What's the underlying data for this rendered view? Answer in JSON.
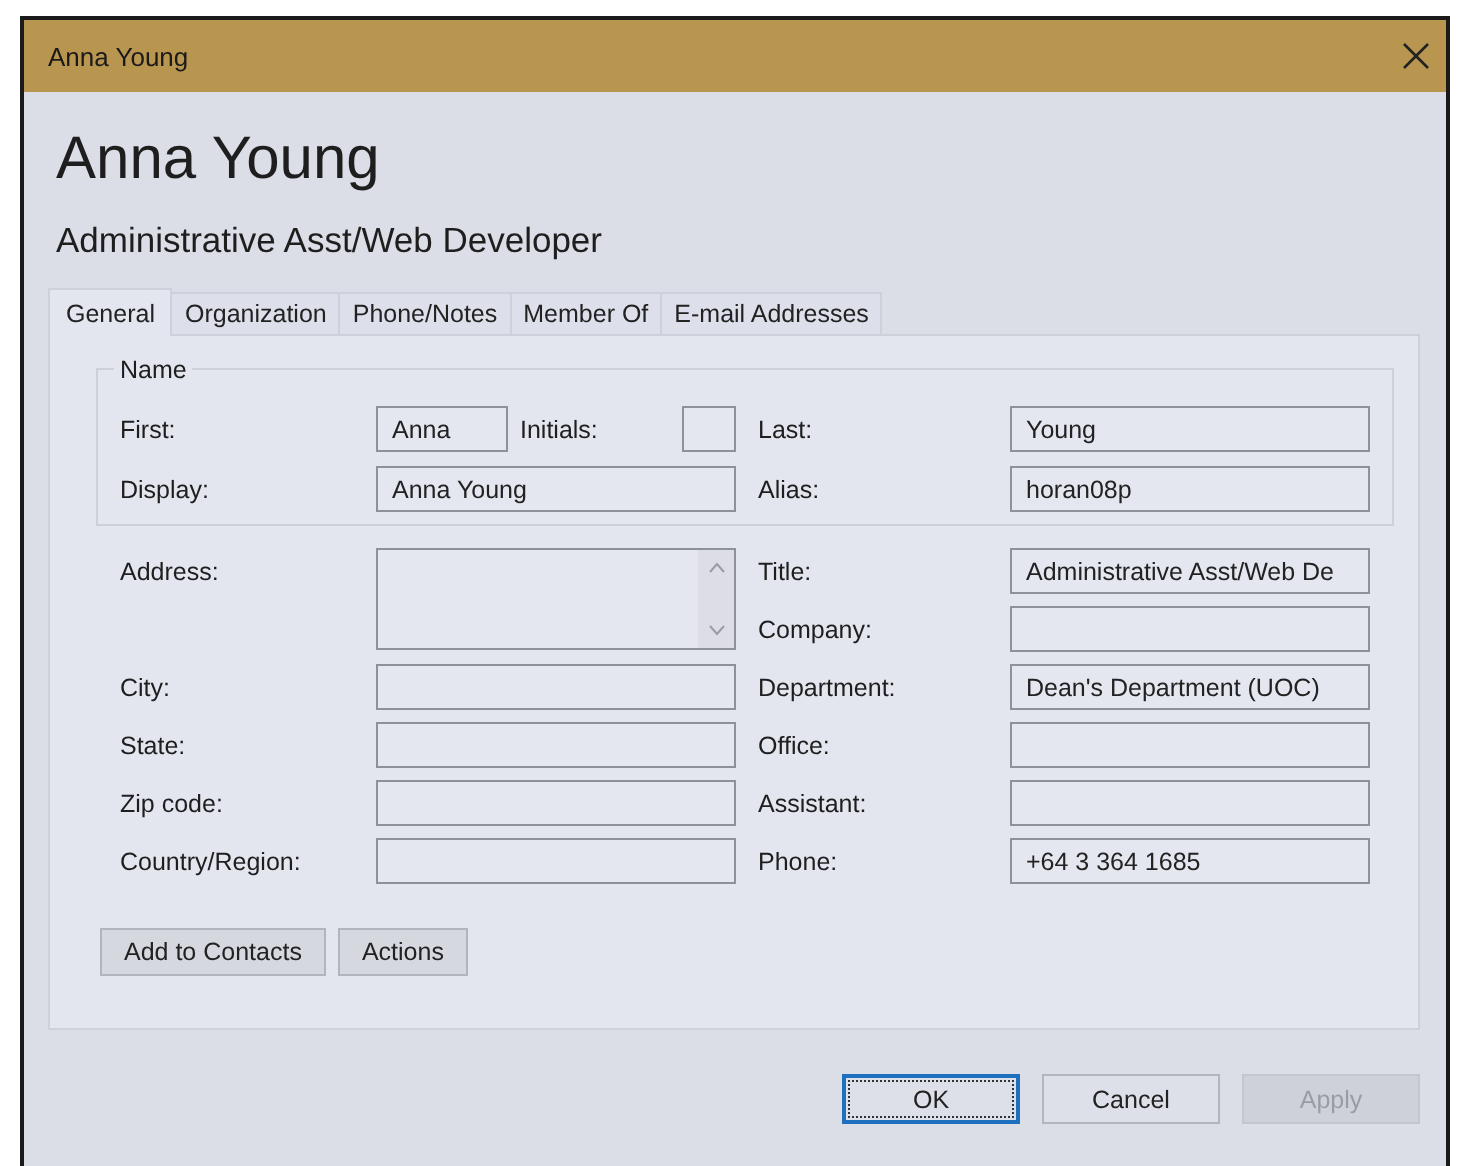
{
  "window": {
    "title": "Anna Young"
  },
  "heading": "Anna Young",
  "subtitle": "Administrative Asst/Web Developer",
  "tabs": [
    {
      "label": "General",
      "selected": true
    },
    {
      "label": "Organization",
      "selected": false
    },
    {
      "label": "Phone/Notes",
      "selected": false
    },
    {
      "label": "Member Of",
      "selected": false
    },
    {
      "label": "E-mail Addresses",
      "selected": false
    }
  ],
  "name_group": {
    "legend": "Name",
    "first": {
      "label": "First:",
      "value": "Anna"
    },
    "initials": {
      "label": "Initials:"
    },
    "last": {
      "label": "Last:",
      "value": "Young"
    },
    "display": {
      "label": "Display:",
      "value": "Anna Young"
    },
    "alias": {
      "label": "Alias:",
      "value": "horan08p"
    }
  },
  "rows": [
    {
      "left": {
        "kind": "multiline",
        "label": "Address:"
      },
      "right": {
        "kind": "text",
        "label": "Title:",
        "value": "Administrative Asst/Web De"
      }
    },
    {
      "right": {
        "kind": "text",
        "label": "Company:"
      }
    },
    {
      "left": {
        "kind": "text",
        "label": "City:"
      },
      "right": {
        "kind": "text",
        "label": "Department:",
        "value": "Dean's Department (UOC)"
      }
    },
    {
      "left": {
        "kind": "text",
        "label": "State:"
      },
      "right": {
        "kind": "text",
        "label": "Office:"
      }
    },
    {
      "left": {
        "kind": "text",
        "label": "Zip code:"
      },
      "right": {
        "kind": "text",
        "label": "Assistant:"
      }
    },
    {
      "left": {
        "kind": "text",
        "label": "Country/Region:"
      },
      "right": {
        "kind": "text",
        "label": "Phone:",
        "value": "+64 3 364 1685"
      }
    }
  ],
  "panel_buttons": [
    "Add to Contacts",
    "Actions"
  ],
  "dialog_buttons": [
    {
      "label": "OK",
      "default": true,
      "disabled": false
    },
    {
      "label": "Cancel",
      "default": false,
      "disabled": false
    },
    {
      "label": "Apply",
      "default": false,
      "disabled": true
    }
  ]
}
